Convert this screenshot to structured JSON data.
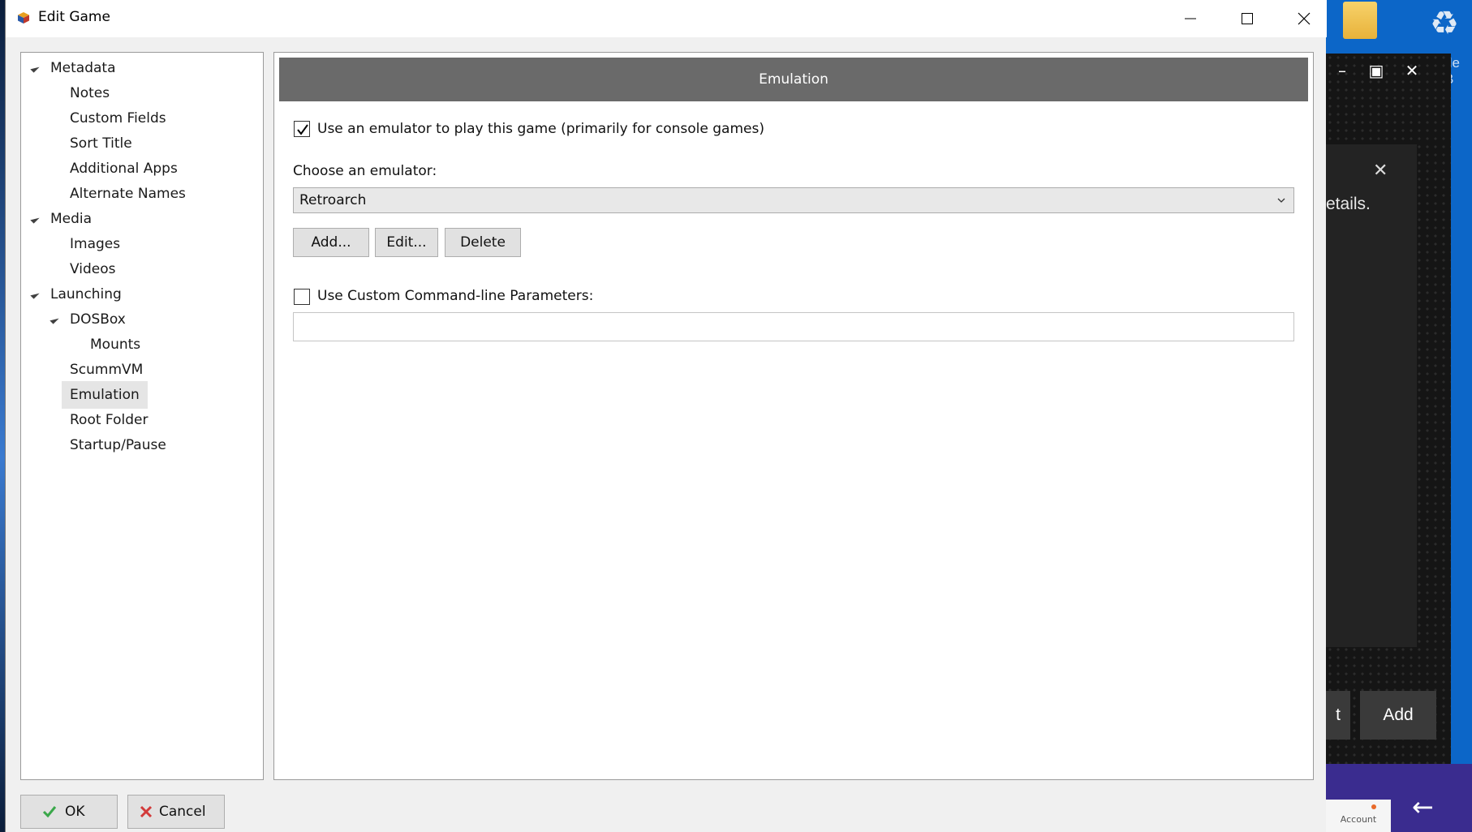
{
  "window": {
    "title": "Edit Game",
    "icon": "app-cube-icon",
    "controls": [
      "minimize-icon",
      "maximize-icon",
      "close-icon"
    ]
  },
  "sidebar": {
    "items": [
      {
        "label": "Metadata",
        "level": 0,
        "expanded": true
      },
      {
        "label": "Notes",
        "level": 1
      },
      {
        "label": "Custom Fields",
        "level": 1
      },
      {
        "label": "Sort Title",
        "level": 1
      },
      {
        "label": "Additional Apps",
        "level": 1
      },
      {
        "label": "Alternate Names",
        "level": 1
      },
      {
        "label": "Media",
        "level": 0,
        "expanded": true
      },
      {
        "label": "Images",
        "level": 1
      },
      {
        "label": "Videos",
        "level": 1
      },
      {
        "label": "Launching",
        "level": 0,
        "expanded": true
      },
      {
        "label": "DOSBox",
        "level": 1,
        "expanded": true
      },
      {
        "label": "Mounts",
        "level": 2
      },
      {
        "label": "ScummVM",
        "level": 1
      },
      {
        "label": "Emulation",
        "level": 1,
        "selected": true
      },
      {
        "label": "Root Folder",
        "level": 1
      },
      {
        "label": "Startup/Pause",
        "level": 1
      }
    ]
  },
  "main": {
    "section_title": "Emulation",
    "use_emulator": {
      "label": "Use an emulator to play this game (primarily for console games)",
      "checked": true
    },
    "choose_label": "Choose an emulator:",
    "emulator_select": {
      "value": "Retroarch"
    },
    "buttons": {
      "add": "Add...",
      "edit": "Edit...",
      "delete": "Delete"
    },
    "custom_params": {
      "label": "Use Custom Command-line Parameters:",
      "checked": false,
      "value": ""
    }
  },
  "footer": {
    "ok": "OK",
    "cancel": "Cancel"
  },
  "background_window": {
    "details_text": "etails.",
    "button_partial": "t",
    "button_add": "Add",
    "account_label": "Account",
    "desktop_text": "de B"
  },
  "colors": {
    "header_bg": "#6a6a6a",
    "selected_item_bg": "#e5e5e5",
    "ok_check": "#3aa84a",
    "cancel_x": "#d23a3a"
  }
}
